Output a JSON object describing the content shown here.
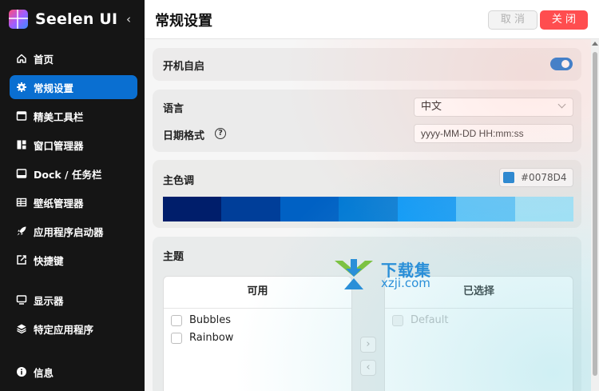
{
  "app": {
    "name": "Seelen UI"
  },
  "sidebar": {
    "items": [
      {
        "label": "首页",
        "icon": "home-icon"
      },
      {
        "label": "常规设置",
        "icon": "gear-icon",
        "active": true
      },
      {
        "label": "精美工具栏",
        "icon": "toolbar-icon"
      },
      {
        "label": "窗口管理器",
        "icon": "window-manager-icon"
      },
      {
        "label": "Dock / 任务栏",
        "icon": "dock-icon"
      },
      {
        "label": "壁纸管理器",
        "icon": "wallpaper-icon"
      },
      {
        "label": "应用程序启动器",
        "icon": "rocket-icon"
      },
      {
        "label": "快捷键",
        "icon": "shortcut-icon"
      },
      {
        "label": "显示器",
        "icon": "monitor-icon"
      },
      {
        "label": "特定应用程序",
        "icon": "layers-icon"
      }
    ],
    "bottom": {
      "label": "信息",
      "icon": "info-icon"
    }
  },
  "header": {
    "title": "常规设置",
    "cancel_label": "取 消",
    "close_label": "关 闭"
  },
  "settings": {
    "autostart": {
      "label": "开机自启",
      "enabled": true
    },
    "language": {
      "label": "语言",
      "value": "中文"
    },
    "date_format": {
      "label": "日期格式",
      "value": "yyyy-MM-DD HH:mm:ss"
    },
    "accent": {
      "label": "主色调",
      "value": "#0078D4",
      "palette": [
        "#001e6b",
        "#003e99",
        "#0061c4",
        "#0078d4",
        "#0095fa",
        "#4cc2ff",
        "#99e5ff"
      ]
    }
  },
  "theme": {
    "label": "主题",
    "available_header": "可用",
    "selected_header": "已选择",
    "available": [
      "Bubbles",
      "Rainbow"
    ],
    "selected": [
      "Default"
    ]
  },
  "watermark": {
    "title": "下载集",
    "subtitle": "xzji.com"
  },
  "colors": {
    "accent": "#0a6fd1",
    "close_button": "#ff4d4f",
    "sidebar": "#151515"
  }
}
